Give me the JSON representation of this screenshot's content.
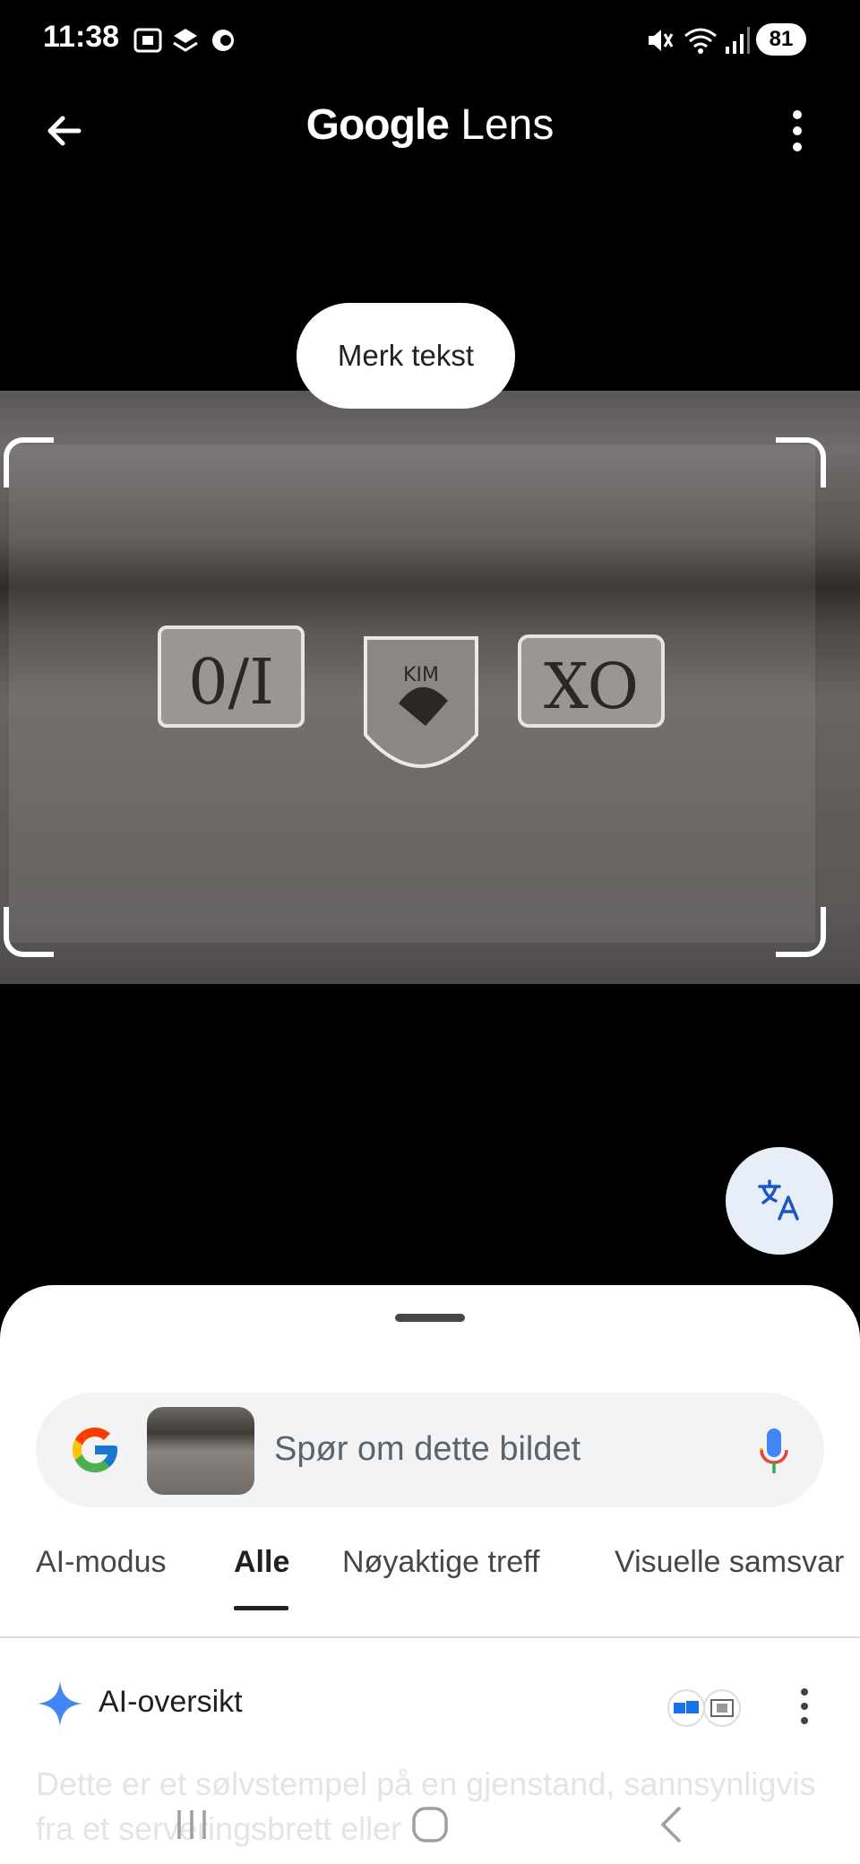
{
  "status_bar": {
    "time": "11:38",
    "battery": "81"
  },
  "app_bar": {
    "title_brand": "Google",
    "title_product": "Lens"
  },
  "image": {
    "select_text_label": "Merk tekst"
  },
  "search": {
    "placeholder": "Spør om dette bildet"
  },
  "tabs": [
    {
      "label": "AI-modus",
      "active": false
    },
    {
      "label": "Alle",
      "active": true
    },
    {
      "label": "Nøyaktige treff",
      "active": false
    },
    {
      "label": "Visuelle samsvar",
      "active": false
    }
  ],
  "ai_overview": {
    "title": "AI-oversikt",
    "text": "Dette er et sølvstempel på en gjenstand, sannsynligvis fra et serveringsbrett eller"
  },
  "hallmarks": {
    "left": "0/I",
    "right": "XO",
    "center": "KIM"
  },
  "colors": {
    "accent_blue": "#4285f4",
    "sheet_bg": "#ffffff",
    "search_bg": "#f1f3f4",
    "translate_bg": "#e8eef8"
  },
  "icons": [
    "back-arrow-icon",
    "more-vert-icon",
    "translate-icon",
    "google-g-icon",
    "mic-icon",
    "sparkle-icon",
    "recents-icon",
    "home-icon",
    "back-nav-icon"
  ]
}
